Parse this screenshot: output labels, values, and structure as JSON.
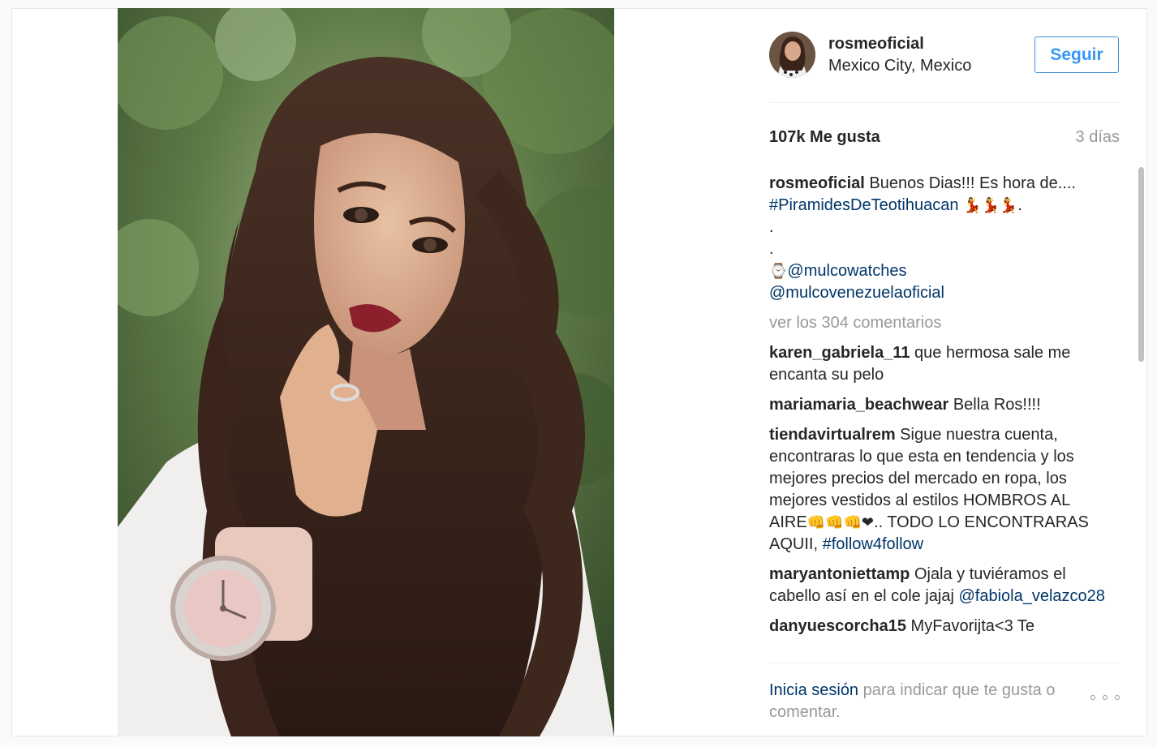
{
  "post": {
    "author": "rosmeoficial",
    "location": "Mexico City, Mexico",
    "follow_label": "Seguir",
    "likes": "107k Me gusta",
    "age": "3 días",
    "photo_icon": "selfie-photo"
  },
  "caption": {
    "username": "rosmeoficial",
    "text": "Buenos Dias!!! Es hora de....",
    "hashtag": "#PiramidesDeTeotihuacan",
    "dancer_emoji": "💃💃💃",
    "after_hashtag": ".",
    "dot1": ".",
    "dot2": ".",
    "watch_emoji": "⌚",
    "mention1": "@mulcowatches",
    "mention2": "@mulcovenezuelaoficial"
  },
  "view_comments": "ver los 304 comentarios",
  "comments": [
    {
      "username": "karen_gabriela_11",
      "text": "que hermosa sale me encanta su pelo"
    },
    {
      "username": "mariamaria_beachwear",
      "text": "Bella Ros!!!!"
    },
    {
      "username": "tiendavirtualrem",
      "text": "Sigue nuestra cuenta, encontraras lo que esta en tendencia y los mejores precios del mercado en ropa, los mejores vestidos al estilos HOMBROS AL AIRE",
      "emoji": "👊👊👊❤",
      "text2": ".. TODO LO ENCONTRARAS AQUII,",
      "hashtag": "#follow4follow"
    },
    {
      "username": "maryantoniettamp",
      "text": "Ojala y tuviéramos el cabello así en el cole jajaj",
      "mention": "@fabiola_velazco28"
    },
    {
      "username": "danyuescorcha15",
      "text": "MyFavorijta<3 Te"
    }
  ],
  "footer": {
    "login_link": "Inicia sesión",
    "login_rest": "para indicar que te gusta o comentar.",
    "more_icon": "more-options-icon"
  },
  "colors": {
    "link": "#003569",
    "follow_blue": "#3897f0",
    "muted": "#999999",
    "text": "#262626"
  }
}
